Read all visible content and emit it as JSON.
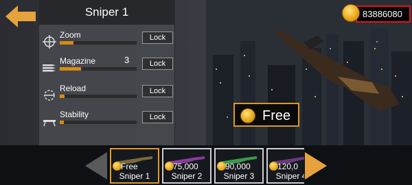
{
  "panel": {
    "title": "Sniper 1"
  },
  "stats": [
    {
      "label": "Zoom",
      "value": "",
      "level": 0.18,
      "button": "Lock",
      "icon": "crosshair-icon"
    },
    {
      "label": "Magazine",
      "value": "3",
      "level": 0.28,
      "button": "Lock",
      "icon": "bullets-icon"
    },
    {
      "label": "Reload",
      "value": "",
      "level": 0.06,
      "button": "Lock",
      "icon": "reload-icon"
    },
    {
      "label": "Stability",
      "value": "",
      "level": 0.05,
      "button": "Lock",
      "icon": "bipod-icon"
    }
  ],
  "coins": {
    "amount": "83886080"
  },
  "free_button": {
    "label": "Free"
  },
  "weapons": [
    {
      "price": "Free",
      "name": "Sniper 1",
      "selected": true,
      "color": "#7a6a3a"
    },
    {
      "price": "75,000",
      "name": "Sniper 2",
      "selected": false,
      "color": "#7a3a8a"
    },
    {
      "price": "90,000",
      "name": "Sniper 3",
      "selected": false,
      "color": "#3a8a4a"
    },
    {
      "price": "120,0",
      "name": "Sniper 4",
      "selected": false,
      "color": "#5a3a6a"
    }
  ],
  "colors": {
    "accent": "#d98a14",
    "coin_border": "#e3151b"
  }
}
